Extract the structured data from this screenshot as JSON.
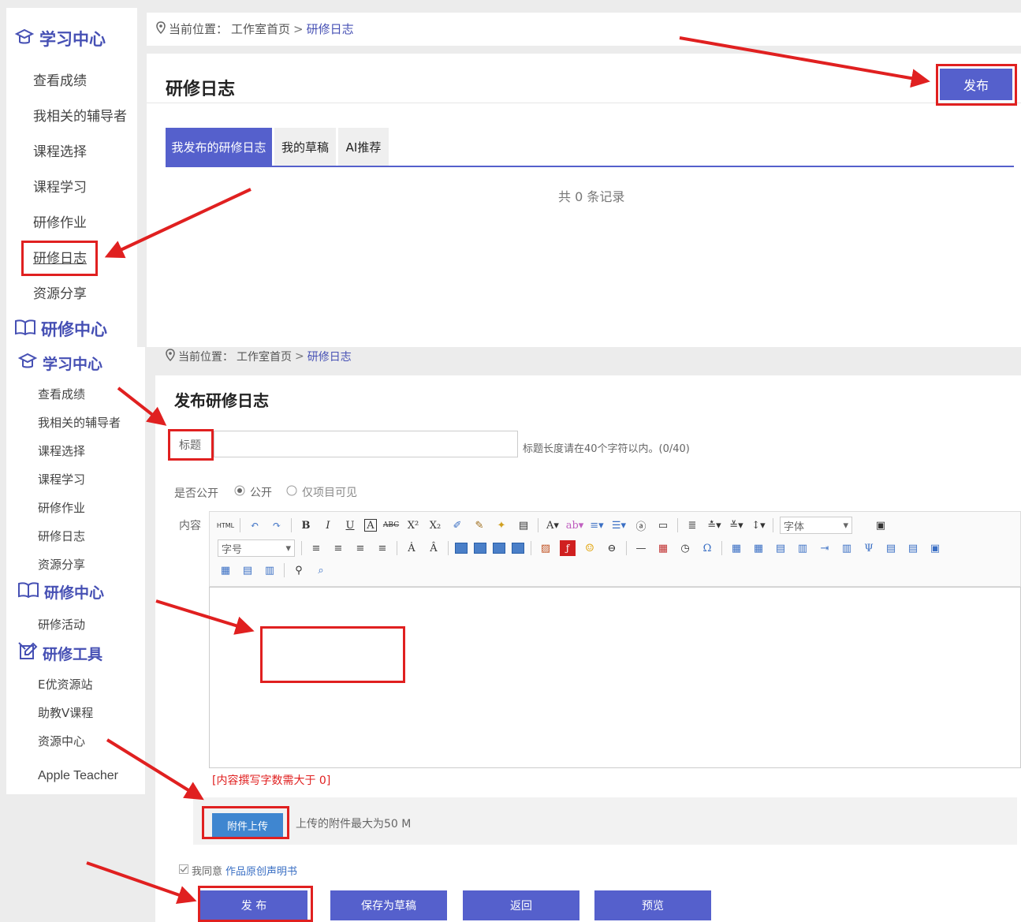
{
  "colors": {
    "accent": "#5560cc",
    "highlight_red": "#e02020",
    "link": "#4650b4"
  },
  "top": {
    "sidebar": {
      "section_title": "学习中心",
      "section_icon": "study-center-icon",
      "items": [
        {
          "label": "查看成绩"
        },
        {
          "label": "我相关的辅导者"
        },
        {
          "label": "课程选择"
        },
        {
          "label": "课程学习"
        },
        {
          "label": "研修作业"
        },
        {
          "label": "研修日志"
        },
        {
          "label": "资源分享"
        }
      ],
      "section2_title": "研修中心",
      "section2_icon": "book-icon"
    },
    "breadcrumb": {
      "prefix": "当前位置：",
      "home": "工作室首页",
      "separator": ">",
      "current": "研修日志"
    },
    "panel": {
      "title": "研修日志",
      "publish_button": "发布",
      "tabs": [
        {
          "label": "我发布的研修日志"
        },
        {
          "label": "我的草稿"
        },
        {
          "label": "AI推荐"
        }
      ],
      "record_count": "共 0 条记录"
    }
  },
  "bottom": {
    "sidebar": {
      "sections": [
        {
          "title": "学习中心",
          "icon": "study-center-icon"
        },
        {
          "title": "研修中心",
          "icon": "book-icon"
        },
        {
          "title": "研修工具",
          "icon": "tools-icon"
        }
      ],
      "items_study": [
        "查看成绩",
        "我相关的辅导者",
        "课程选择",
        "课程学习",
        "研修作业",
        "研修日志",
        "资源分享"
      ],
      "items_research": [
        "研修活动"
      ],
      "items_tools": [
        "E优资源站",
        "助教V课程",
        "资源中心",
        "Apple Teacher"
      ]
    },
    "breadcrumb": {
      "prefix": "当前位置：",
      "home": "工作室首页",
      "separator": ">",
      "current": "研修日志"
    },
    "form": {
      "title": "发布研修日志",
      "title_label": "标题",
      "title_value": "",
      "title_hint": "标题长度请在40个字符以内。(0/40)",
      "public_label": "是否公开",
      "public_option": "公开",
      "project_option": "仅项目可见",
      "content_label": "内容",
      "font_select": "字体",
      "size_select": "字号",
      "content_hint": "[内容撰写字数需大于 0]",
      "upload_button": "附件上传",
      "upload_hint": "上传的附件最大为50 M",
      "agree_prefix": "我同意",
      "agree_link": "作品原创声明书",
      "buttons": {
        "publish": "发 布",
        "save_draft": "保存为草稿",
        "back": "返回",
        "preview": "预览"
      }
    }
  }
}
